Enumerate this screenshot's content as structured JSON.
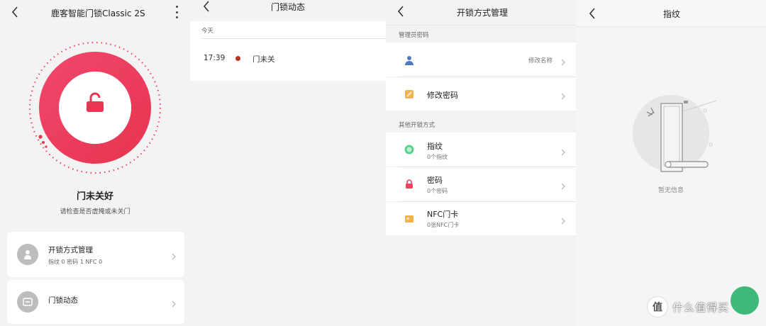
{
  "panel1": {
    "title": "鹿客智能门锁Classic 2S",
    "status_title": "门未关好",
    "status_sub": "请检查是否虚掩或未关门",
    "cards": [
      {
        "title": "开锁方式管理",
        "sub": "指纹 0  密码 1  NFC 0",
        "icon": "key-person-icon"
      },
      {
        "title": "门锁动态",
        "sub": "",
        "icon": "card-icon"
      }
    ],
    "accent": "#ee3e5e"
  },
  "panel2": {
    "title": "门锁动态",
    "section": "今天",
    "events": [
      {
        "time": "17:39",
        "text": "门未关",
        "dot_color": "#c0311f"
      }
    ]
  },
  "panel3": {
    "title": "开锁方式管理",
    "section_admin": "管理员密码",
    "admin_rows": [
      {
        "title": "",
        "right": "修改名称",
        "icon": "person-icon"
      },
      {
        "title": "修改密码",
        "right": "",
        "icon": "edit-icon"
      }
    ],
    "section_other": "其他开锁方式",
    "other_rows": [
      {
        "title": "指纹",
        "sub": "0个指纹",
        "icon": "fingerprint-icon",
        "color": "#55d48f"
      },
      {
        "title": "密码",
        "sub": "0个密码",
        "icon": "lock-icon",
        "color": "#e6455b"
      },
      {
        "title": "NFC门卡",
        "sub": "0张NFC门卡",
        "icon": "nfc-card-icon",
        "color": "#f3b34a"
      }
    ]
  },
  "panel4": {
    "title": "指纹",
    "empty_text": "暂无信息"
  },
  "watermark": {
    "badge": "值",
    "text": "什么值得买"
  }
}
